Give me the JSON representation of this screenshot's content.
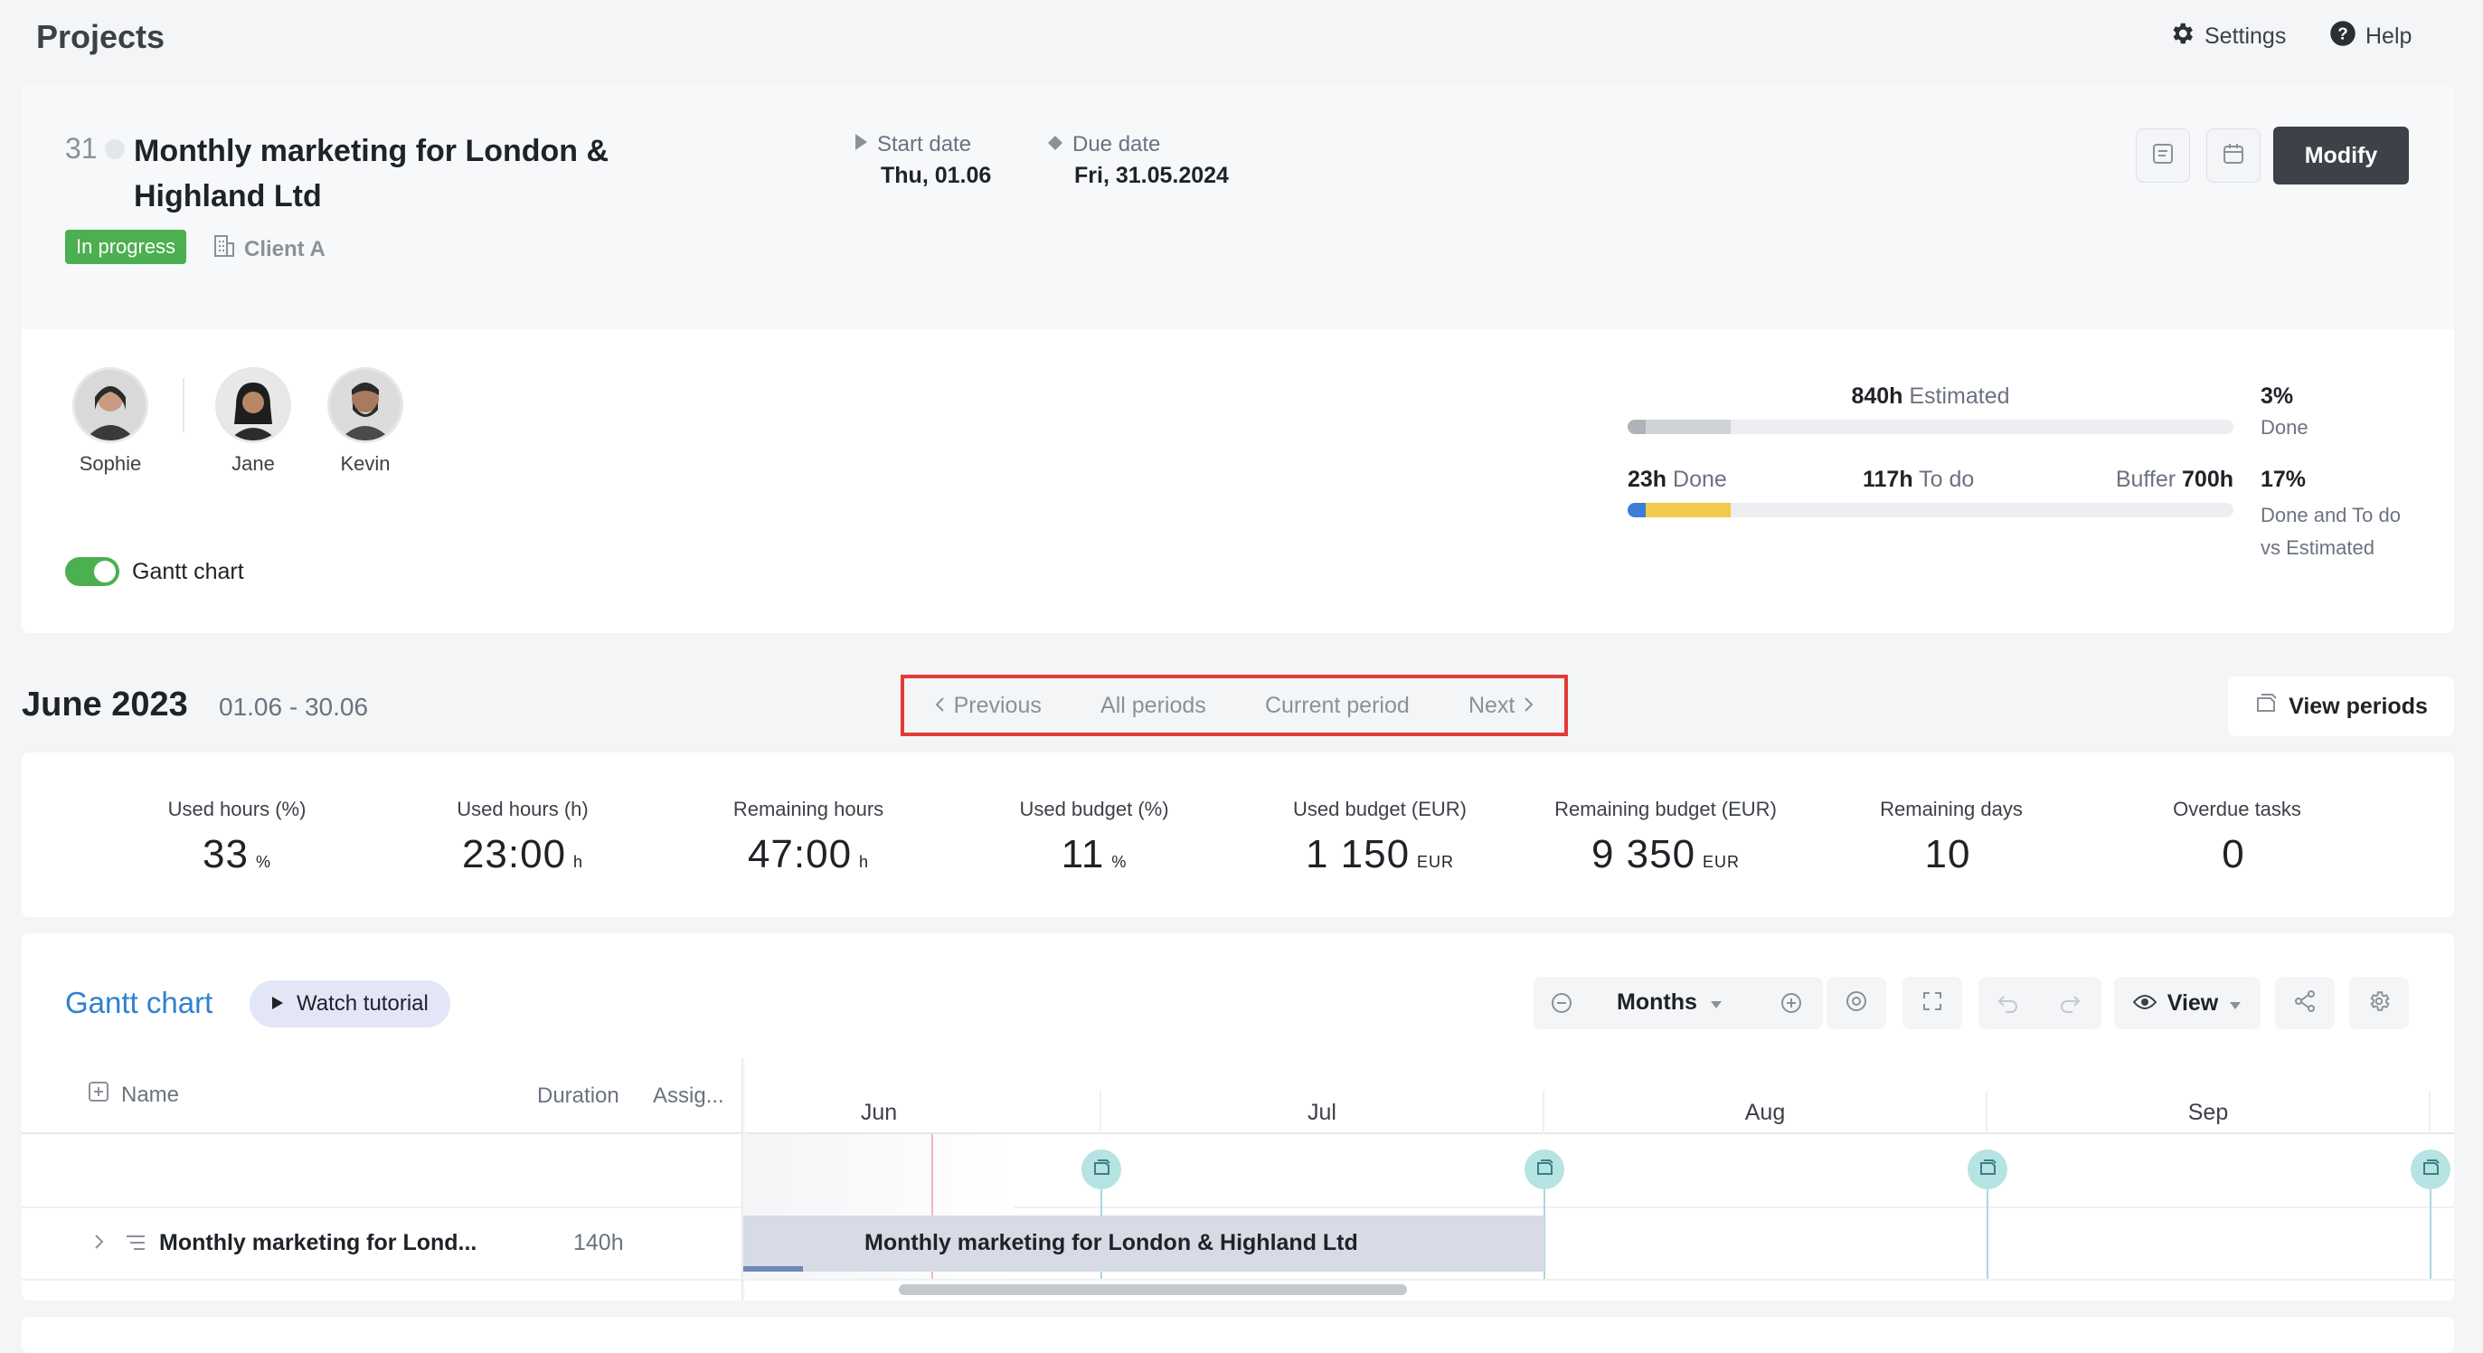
{
  "header": {
    "title": "Projects",
    "settings_label": "Settings",
    "help_label": "Help"
  },
  "project": {
    "id": "31",
    "name_line1": "Monthly marketing for London &",
    "name_line2": "Highland Ltd",
    "status": "In progress",
    "client": "Client A",
    "start_label": "Start date",
    "start_value": "Thu, 01.06",
    "due_label": "Due date",
    "due_value": "Fri, 31.05.2024",
    "modify_label": "Modify"
  },
  "team": [
    {
      "name": "Sophie"
    },
    {
      "name": "Jane"
    },
    {
      "name": "Kevin"
    }
  ],
  "gantt_toggle": {
    "label": "Gantt chart",
    "on": true
  },
  "estimates": {
    "estimated_value": "840h",
    "estimated_label": "Estimated",
    "done_pct": "3%",
    "done_pct_label": "Done",
    "done_value": "23h",
    "done_label": "Done",
    "todo_value": "117h",
    "todo_label": "To do",
    "buffer_label": "Buffer",
    "buffer_value": "700h",
    "combined_pct": "17%",
    "combined_label_1": "Done and To do",
    "combined_label_2": "vs Estimated",
    "bar1_done_fraction": 0.03,
    "bar1_todo_fraction": 0.14,
    "bar2_done_fraction": 0.03,
    "bar2_todo_fraction": 0.14
  },
  "period": {
    "title": "June 2023",
    "range": "01.06 - 30.06",
    "nav_previous": "Previous",
    "nav_all": "All periods",
    "nav_current": "Current period",
    "nav_next": "Next",
    "view_periods_label": "View periods"
  },
  "stats": [
    {
      "label": "Used hours (%)",
      "value": "33",
      "unit": "%"
    },
    {
      "label": "Used hours (h)",
      "value": "23:00",
      "unit": "h"
    },
    {
      "label": "Remaining hours",
      "value": "47:00",
      "unit": "h"
    },
    {
      "label": "Used budget (%)",
      "value": "11",
      "unit": "%"
    },
    {
      "label": "Used budget (EUR)",
      "value": "1 150",
      "unit": "EUR"
    },
    {
      "label": "Remaining budget (EUR)",
      "value": "9 350",
      "unit": "EUR"
    },
    {
      "label": "Remaining days",
      "value": "10",
      "unit": ""
    },
    {
      "label": "Overdue tasks",
      "value": "0",
      "unit": ""
    }
  ],
  "gantt": {
    "title": "Gantt chart",
    "tutorial_label": "Watch tutorial",
    "scale_label": "Months",
    "view_label": "View",
    "columns": {
      "name": "Name",
      "duration": "Duration",
      "assignee": "Assig..."
    },
    "months": [
      "Jun",
      "Jul",
      "Aug",
      "Sep"
    ],
    "rows": [
      {
        "name": "Monthly marketing for Lond...",
        "duration": "140h",
        "bar_label": "Monthly marketing for London & Highland Ltd"
      }
    ]
  },
  "colors": {
    "accent_blue": "#2f80d1",
    "status_green": "#4caf50",
    "done_blue": "#3b7dd8",
    "todo_yellow": "#f2c94c",
    "highlight_red": "#e53935",
    "dark_button": "#3d4249",
    "milestone_teal": "#b5e4e2"
  }
}
